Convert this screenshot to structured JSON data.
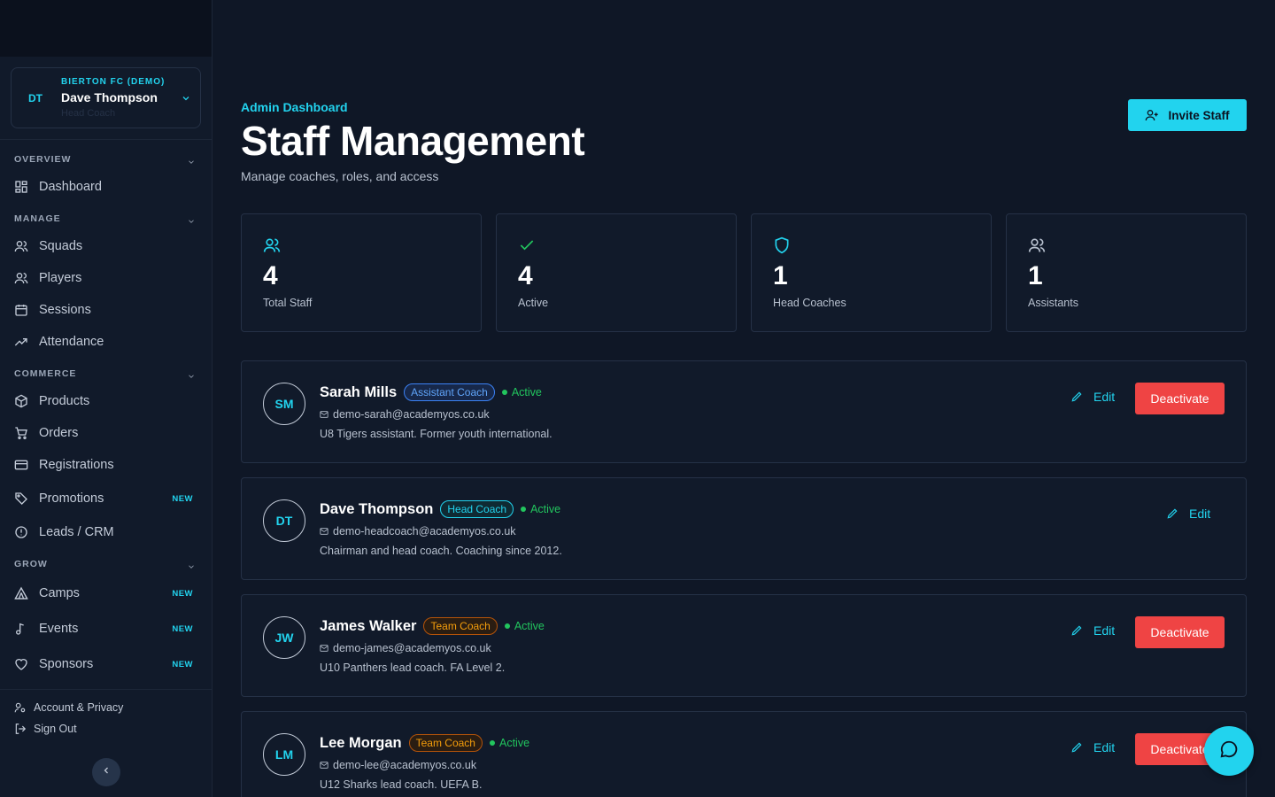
{
  "user": {
    "initials": "DT",
    "club": "BIERTON FC (DEMO)",
    "name": "Dave Thompson",
    "role": "Head Coach"
  },
  "nav": {
    "overview": {
      "label": "OVERVIEW",
      "items": [
        {
          "label": "Dashboard",
          "icon": "dashboard-icon"
        }
      ]
    },
    "manage": {
      "label": "MANAGE",
      "items": [
        {
          "label": "Squads",
          "icon": "users-icon"
        },
        {
          "label": "Players",
          "icon": "users-icon"
        },
        {
          "label": "Sessions",
          "icon": "calendar-icon"
        },
        {
          "label": "Attendance",
          "icon": "trending-icon"
        }
      ]
    },
    "commerce": {
      "label": "COMMERCE",
      "items": [
        {
          "label": "Products",
          "icon": "package-icon"
        },
        {
          "label": "Orders",
          "icon": "cart-icon"
        },
        {
          "label": "Registrations",
          "icon": "card-icon"
        },
        {
          "label": "Promotions",
          "icon": "tag-icon",
          "badge": "NEW"
        },
        {
          "label": "Leads / CRM",
          "icon": "alert-circle-icon"
        }
      ]
    },
    "grow": {
      "label": "GROW",
      "items": [
        {
          "label": "Camps",
          "icon": "tent-icon",
          "badge": "NEW"
        },
        {
          "label": "Events",
          "icon": "music-icon",
          "badge": "NEW"
        },
        {
          "label": "Sponsors",
          "icon": "heart-icon",
          "badge": "NEW"
        }
      ]
    },
    "footer": {
      "account": "Account & Privacy",
      "signout": "Sign Out"
    }
  },
  "page": {
    "eyebrow": "Admin Dashboard",
    "title": "Staff Management",
    "subtitle": "Manage coaches, roles, and access",
    "invite_label": "Invite Staff"
  },
  "stats": [
    {
      "value": "4",
      "label": "Total Staff",
      "icon": "users-icon"
    },
    {
      "value": "4",
      "label": "Active",
      "icon": "check-icon"
    },
    {
      "value": "1",
      "label": "Head Coaches",
      "icon": "shield-icon"
    },
    {
      "value": "1",
      "label": "Assistants",
      "icon": "users-icon"
    }
  ],
  "staff": [
    {
      "initials": "SM",
      "name": "Sarah Mills",
      "role": "Assistant Coach",
      "status": "Active",
      "email": "demo-sarah@academyos.co.uk",
      "bio": "U8 Tigers assistant. Former youth international.",
      "edit": "Edit",
      "deactivate": "Deactivate"
    },
    {
      "initials": "DT",
      "name": "Dave Thompson",
      "role": "Head Coach",
      "status": "Active",
      "email": "demo-headcoach@academyos.co.uk",
      "bio": "Chairman and head coach. Coaching since 2012.",
      "edit": "Edit"
    },
    {
      "initials": "JW",
      "name": "James Walker",
      "role": "Team Coach",
      "status": "Active",
      "email": "demo-james@academyos.co.uk",
      "bio": "U10 Panthers lead coach. FA Level 2.",
      "edit": "Edit",
      "deactivate": "Deactivate"
    },
    {
      "initials": "LM",
      "name": "Lee Morgan",
      "role": "Team Coach",
      "status": "Active",
      "email": "demo-lee@academyos.co.uk",
      "bio": "U12 Sharks lead coach. UEFA B.",
      "edit": "Edit",
      "deactivate": "Deactivate"
    }
  ],
  "colors": {
    "accent": "#22d3ee",
    "danger": "#ef4444",
    "success": "#22c55e",
    "background": "#0f1726",
    "sidebar": "#111a2a"
  }
}
